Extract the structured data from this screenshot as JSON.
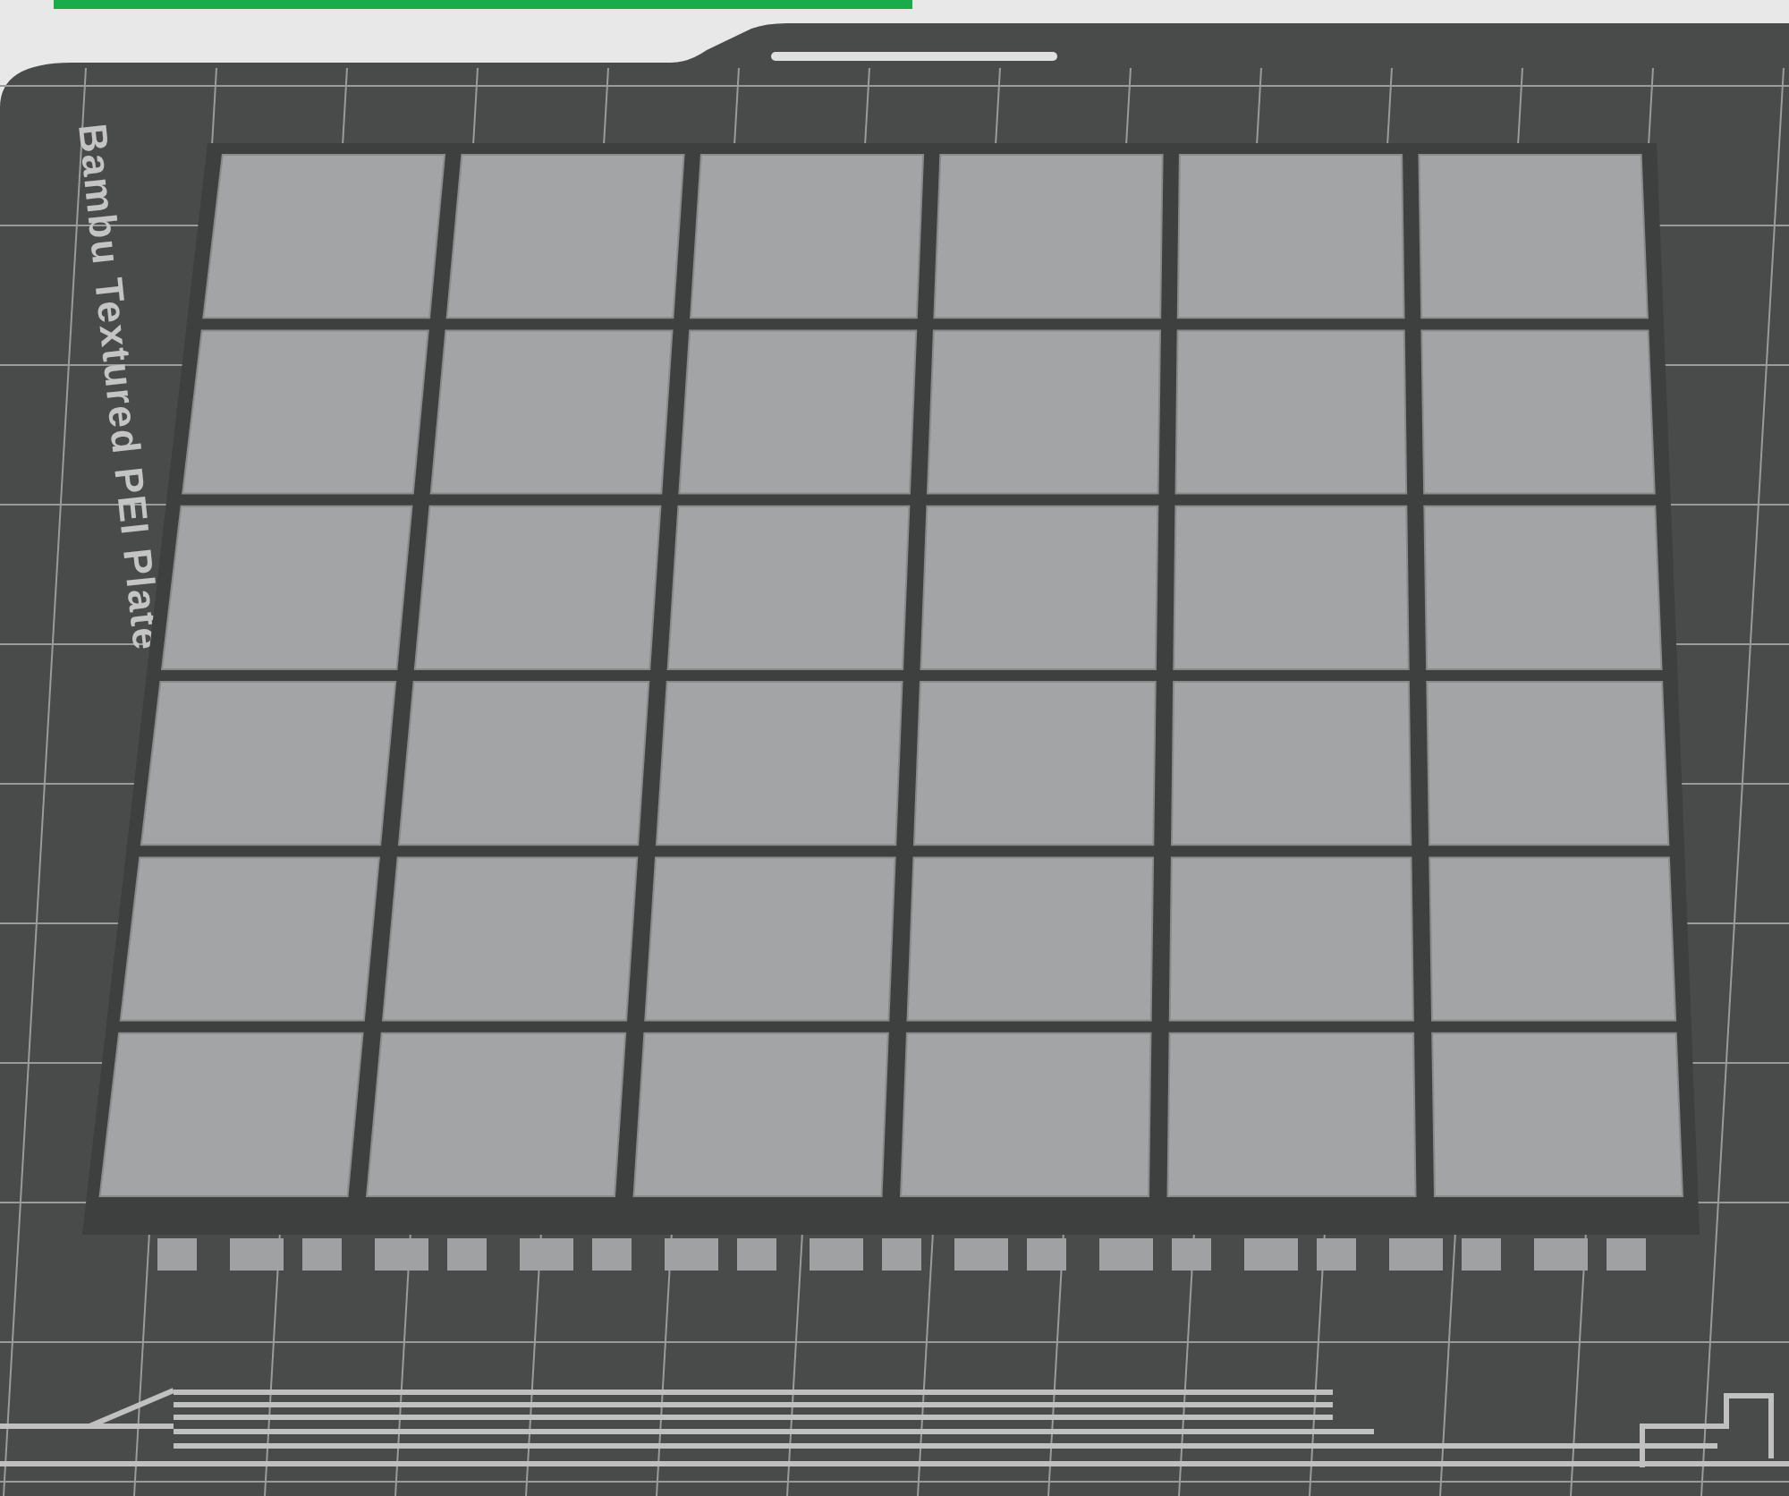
{
  "plate": {
    "label": "Bambu Textured PEI Plate"
  }
}
